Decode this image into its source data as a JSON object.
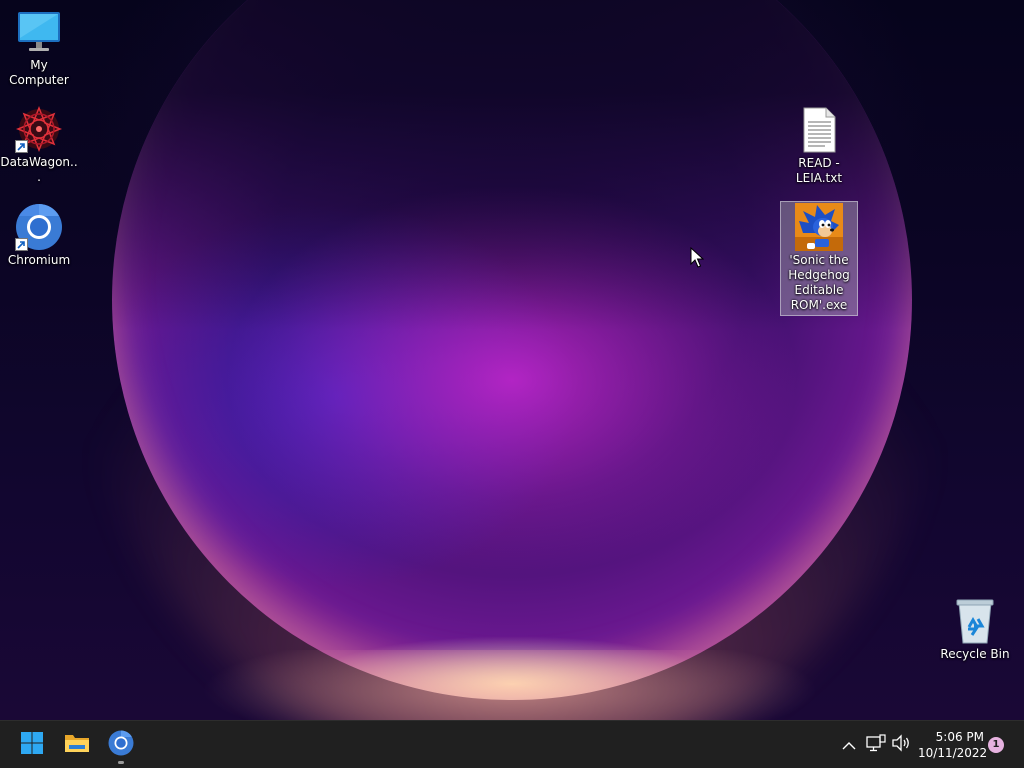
{
  "desktop": {
    "icons": [
      {
        "label": "My Computer",
        "icon": "monitor-icon"
      },
      {
        "label": "DataWagon...",
        "icon": "datawagon-icon",
        "shortcut": true
      },
      {
        "label": "Chromium",
        "icon": "chromium-icon",
        "shortcut": true
      },
      {
        "label": "READ - LEIA.txt",
        "icon": "text-file-icon"
      },
      {
        "label": "'Sonic the Hedgehog Editable ROM'.exe",
        "icon": "sonic-exe-icon",
        "selected": true
      },
      {
        "label": "Recycle Bin",
        "icon": "recycle-bin-icon"
      }
    ]
  },
  "taskbar": {
    "pinned": [
      {
        "name": "Start",
        "icon": "windows-start-icon"
      },
      {
        "name": "File Explorer",
        "icon": "folder-icon"
      },
      {
        "name": "Chromium",
        "icon": "chromium-icon",
        "running": true
      }
    ],
    "tray": {
      "icons": [
        "chevron-up-icon",
        "network-icon",
        "volume-icon"
      ],
      "time": "5:06 PM",
      "date": "10/11/2022",
      "notification_count": "1"
    }
  },
  "colors": {
    "taskbar_bg": "#202020",
    "selection": "#aaaab4",
    "accent": "#0078d4"
  }
}
